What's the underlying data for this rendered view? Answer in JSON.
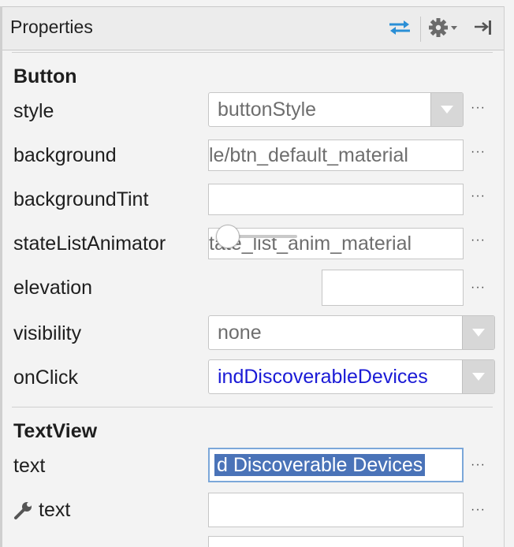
{
  "panel": {
    "title": "Properties",
    "icons": {
      "swap": "swap-arrows-icon",
      "settings": "gear-icon",
      "dropdown": "chevron-down-icon",
      "hide": "hide-panel-icon"
    }
  },
  "sections": {
    "button": {
      "title": "Button",
      "style": {
        "label": "style",
        "value": "buttonStyle"
      },
      "background": {
        "label": "background",
        "value": "le/btn_default_material"
      },
      "backgroundTint": {
        "label": "backgroundTint",
        "value": ""
      },
      "stateListAnimator": {
        "label": "stateListAnimator",
        "value": "tate_list_anim_material"
      },
      "elevation": {
        "label": "elevation",
        "value": "",
        "slider_level": 0
      },
      "visibility": {
        "label": "visibility",
        "value": "none"
      },
      "onClick": {
        "label": "onClick",
        "value": "indDiscoverableDevices"
      }
    },
    "textview": {
      "title": "TextView",
      "text": {
        "label": "text",
        "value": "d Discoverable Devices"
      },
      "tools_text": {
        "label": "text",
        "value": ""
      }
    }
  },
  "ellipsis": "···",
  "colors": {
    "link_blue": "#1a1ad6",
    "selection": "#4a73b8",
    "accent_icon": "#2a8fd6"
  }
}
